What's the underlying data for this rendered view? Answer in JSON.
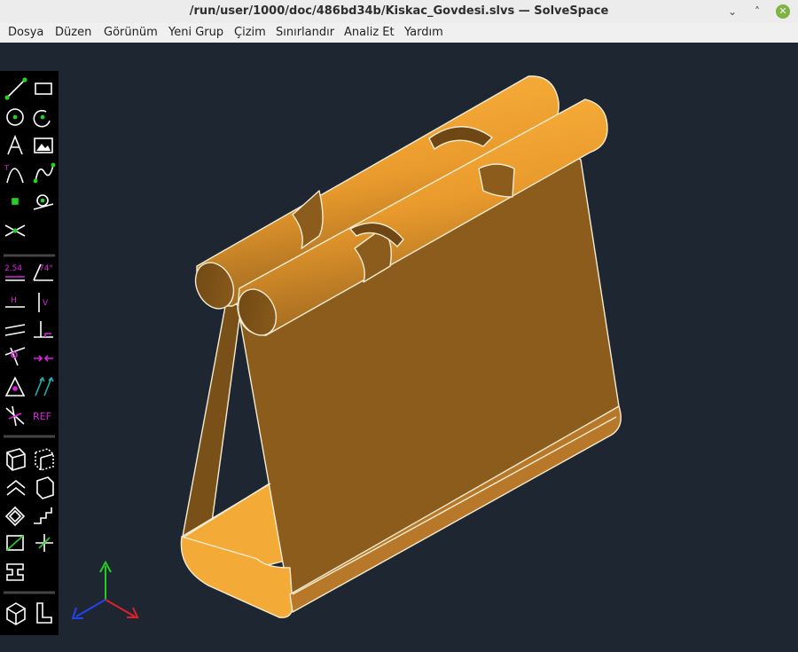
{
  "window": {
    "title": "/run/user/1000/doc/486bd34b/Kiskac_Govdesi.slvs — SolveSpace",
    "minimize_glyph": "⌄",
    "maximize_glyph": "˄",
    "close_glyph": "✕"
  },
  "menu": [
    "Dosya",
    "Düzen",
    "Görünüm",
    "Yeni Grup",
    "Çizim",
    "Sınırlandır",
    "Analiz Et",
    "Yardım"
  ],
  "toolbar": {
    "dimension_label": "2.54",
    "angle_label": "74°",
    "horizontal_label": "H",
    "vertical_label": "V",
    "ref_label": "REF"
  },
  "colors": {
    "background": "#1e2731",
    "solid_face": "#8c5c1c",
    "solid_highlight": "#f4aa36",
    "edge": "#f4ecd2",
    "tool_green": "#22d322",
    "tool_magenta": "#e020e0",
    "axis_x": "#e0202a",
    "axis_y": "#22cc22",
    "axis_z": "#2244ee"
  }
}
